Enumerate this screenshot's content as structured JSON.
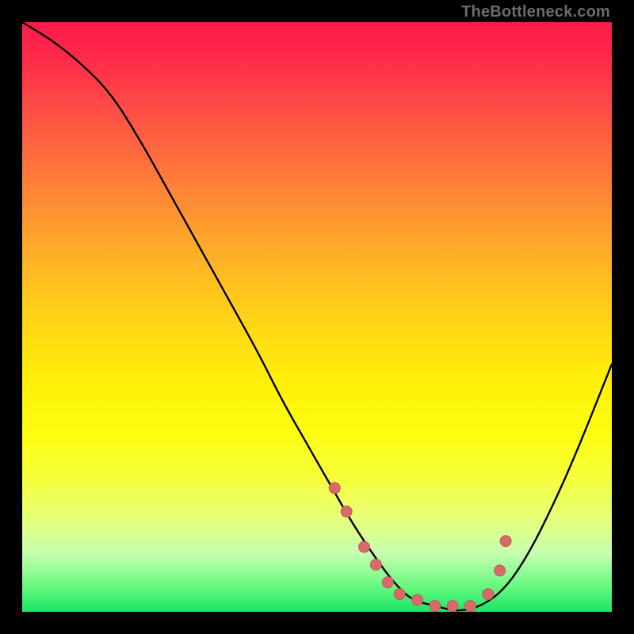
{
  "attribution": "TheBottleneck.com",
  "chart_data": {
    "type": "line",
    "title": "",
    "xlabel": "",
    "ylabel": "",
    "series": [
      {
        "name": "bottleneck-curve",
        "x": [
          0.0,
          0.05,
          0.1,
          0.15,
          0.2,
          0.25,
          0.3,
          0.35,
          0.4,
          0.44,
          0.48,
          0.52,
          0.56,
          0.6,
          0.63,
          0.66,
          0.7,
          0.74,
          0.78,
          0.82,
          0.86,
          0.9,
          0.94,
          1.0
        ],
        "y": [
          1.0,
          0.97,
          0.93,
          0.88,
          0.8,
          0.71,
          0.62,
          0.53,
          0.44,
          0.36,
          0.29,
          0.22,
          0.15,
          0.09,
          0.05,
          0.02,
          0.01,
          0.0,
          0.01,
          0.04,
          0.1,
          0.18,
          0.27,
          0.42
        ]
      }
    ],
    "data_points": {
      "name": "marked-points",
      "x": [
        0.53,
        0.55,
        0.58,
        0.6,
        0.62,
        0.64,
        0.67,
        0.7,
        0.73,
        0.76,
        0.79,
        0.81,
        0.82
      ],
      "y": [
        0.21,
        0.17,
        0.11,
        0.08,
        0.05,
        0.03,
        0.02,
        0.01,
        0.01,
        0.01,
        0.03,
        0.07,
        0.12
      ]
    },
    "xlim": [
      0,
      1
    ],
    "ylim": [
      0,
      1
    ],
    "grid": false,
    "legend": false,
    "background": "rainbow-gradient-vertical"
  },
  "colors": {
    "frame": "#000000",
    "curve": "#000000",
    "dot_fill": "#d96a6a",
    "attribution_text": "#6b6b6b"
  }
}
